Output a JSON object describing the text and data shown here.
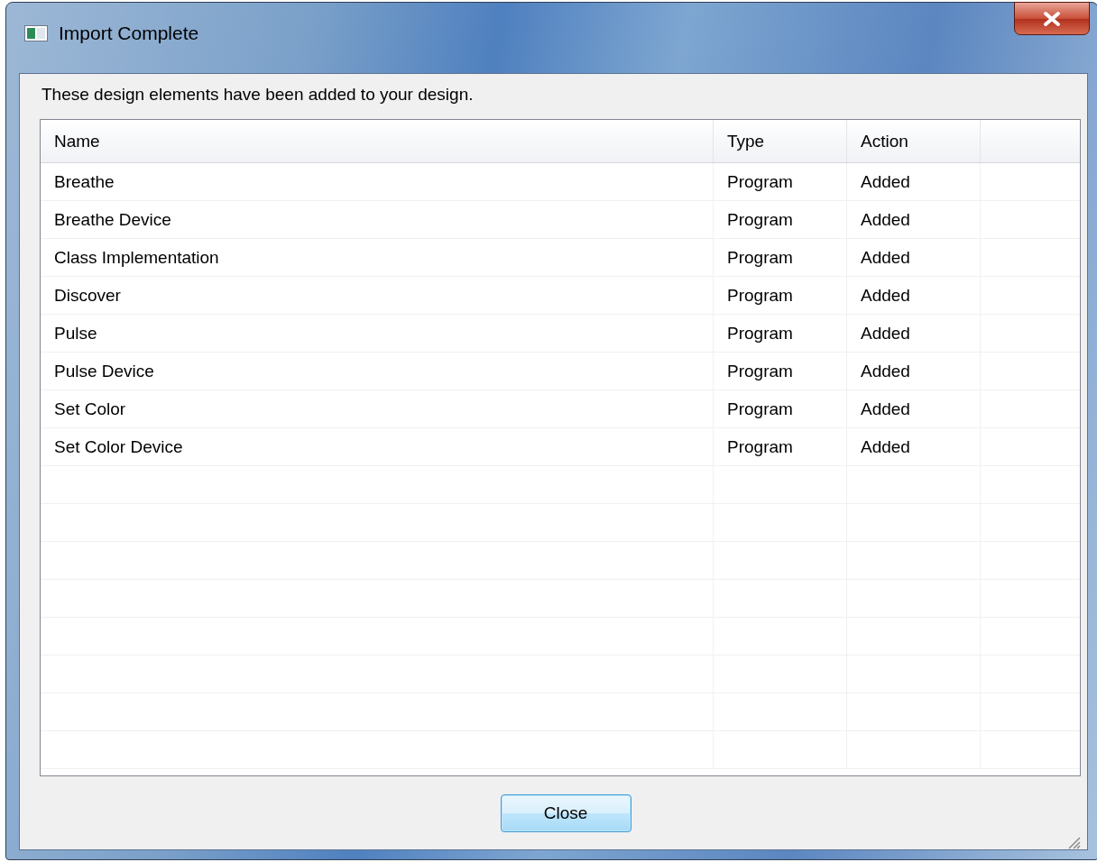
{
  "window": {
    "title": "Import Complete"
  },
  "message": "These design elements have been added to your design.",
  "table": {
    "columns": [
      "Name",
      "Type",
      "Action"
    ],
    "rows": [
      {
        "name": "Breathe",
        "type": "Program",
        "action": "Added"
      },
      {
        "name": "Breathe Device",
        "type": "Program",
        "action": "Added"
      },
      {
        "name": "Class Implementation",
        "type": "Program",
        "action": "Added"
      },
      {
        "name": "Discover",
        "type": "Program",
        "action": "Added"
      },
      {
        "name": "Pulse",
        "type": "Program",
        "action": "Added"
      },
      {
        "name": "Pulse Device",
        "type": "Program",
        "action": "Added"
      },
      {
        "name": "Set Color",
        "type": "Program",
        "action": "Added"
      },
      {
        "name": "Set Color Device",
        "type": "Program",
        "action": "Added"
      }
    ]
  },
  "buttons": [
    "Close"
  ]
}
